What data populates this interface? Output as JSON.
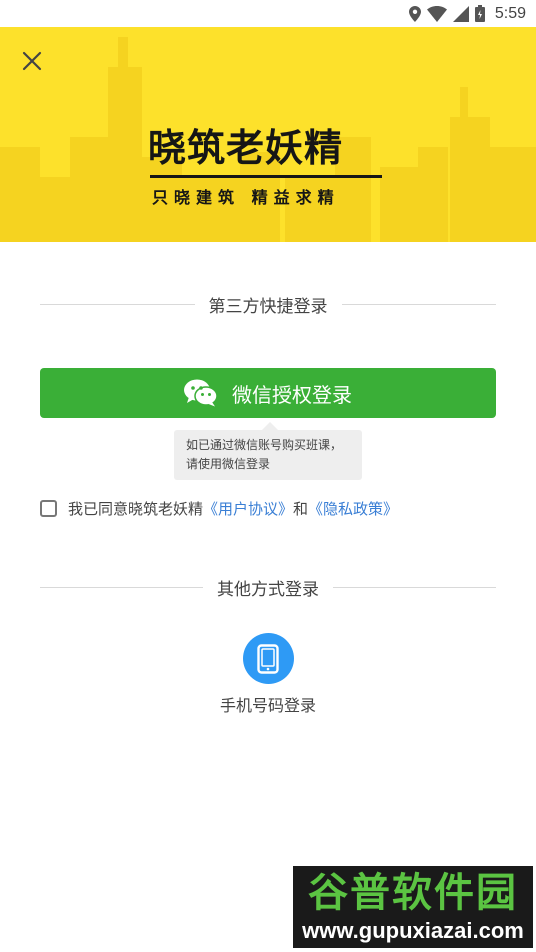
{
  "status_bar": {
    "time": "5:59",
    "icons": [
      "location-icon",
      "wifi-icon",
      "signal-icon",
      "battery-icon"
    ]
  },
  "banner": {
    "background_color": "#fde12b",
    "logo_title": "晓筑老妖精",
    "logo_slogan": "只晓建筑 精益求精",
    "close_icon": "close-icon"
  },
  "third_party": {
    "title": "第三方快捷登录",
    "wechat_button_label": "微信授权登录",
    "wechat_color": "#3aaf37",
    "tooltip": "如已通过微信账号购买班课，请使用微信登录"
  },
  "agreement": {
    "prefix": "我已同意晓筑老妖精",
    "user_agreement_link": "《用户协议》",
    "and": "和",
    "privacy_link": "《隐私政策》",
    "checked": false,
    "link_color": "#3a7fd5"
  },
  "other_methods": {
    "title": "其他方式登录",
    "phone_login_label": "手机号码登录",
    "phone_icon": "phone-icon",
    "phone_color": "#2e9af5"
  },
  "watermark": {
    "title": "谷普软件园",
    "url": "www.gupuxiazai.com"
  }
}
